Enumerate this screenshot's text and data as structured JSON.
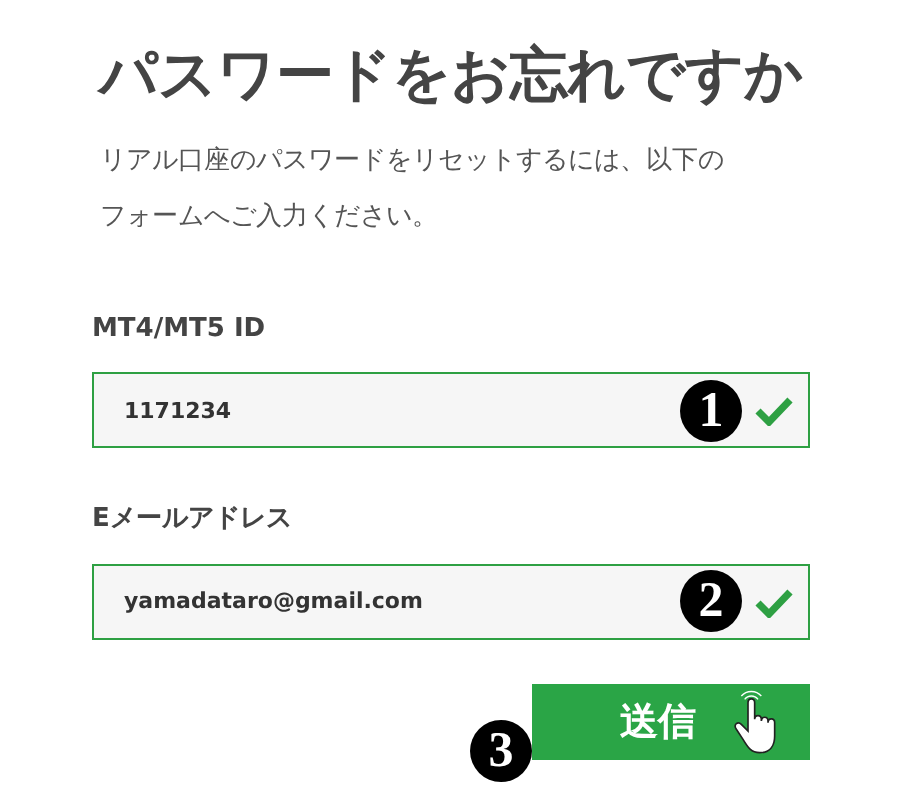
{
  "title": "パスワードをお忘れですか",
  "description": "リアル口座のパスワードをリセットするには、以下のフォームへご入力ください。",
  "fields": [
    {
      "label": "MT4/MT5 ID",
      "value": "1171234",
      "step": "1",
      "valid": true
    },
    {
      "label": "Eメールアドレス",
      "value": "yamadataro@gmail.com",
      "step": "2",
      "valid": true
    }
  ],
  "submit": {
    "label": "送信",
    "step": "3"
  }
}
